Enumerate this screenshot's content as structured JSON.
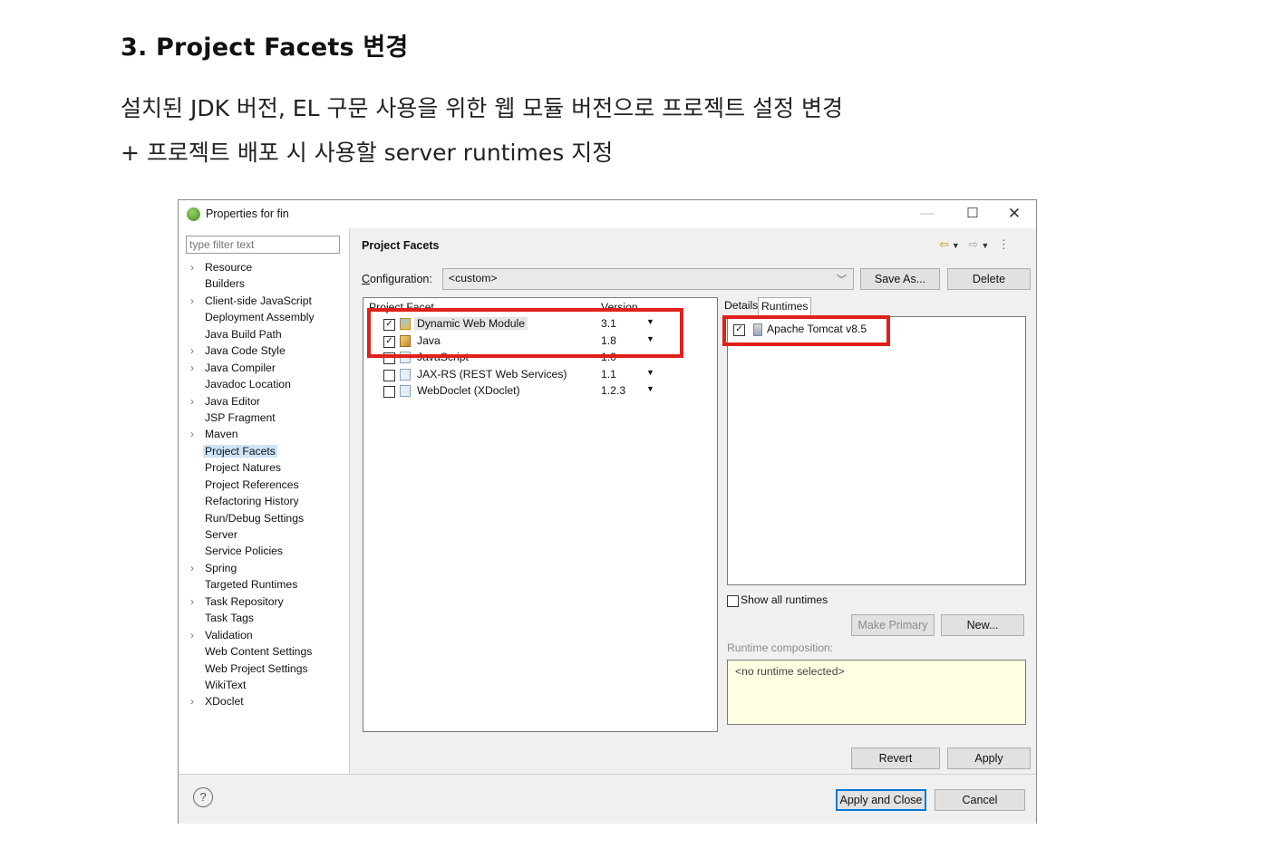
{
  "doc": {
    "heading": "3. Project Facets 변경",
    "line1": "설치된 JDK 버전, EL 구문 사용을 위한 웹 모듈 버전으로 프로젝트 설정 변경",
    "line2": "+ 프로젝트 배포 시 사용할 server runtimes 지정"
  },
  "dialog": {
    "title": "Properties for fin",
    "window_buttons": {
      "minimize": "—",
      "maximize": "☐",
      "close": "✕"
    },
    "filter_placeholder": "type filter text",
    "tree": [
      {
        "label": "Resource",
        "expandable": true,
        "selected": false
      },
      {
        "label": "Builders",
        "expandable": false,
        "selected": false
      },
      {
        "label": "Client-side JavaScript",
        "expandable": true,
        "selected": false
      },
      {
        "label": "Deployment Assembly",
        "expandable": false,
        "selected": false
      },
      {
        "label": "Java Build Path",
        "expandable": false,
        "selected": false
      },
      {
        "label": "Java Code Style",
        "expandable": true,
        "selected": false
      },
      {
        "label": "Java Compiler",
        "expandable": true,
        "selected": false
      },
      {
        "label": "Javadoc Location",
        "expandable": false,
        "selected": false
      },
      {
        "label": "Java Editor",
        "expandable": true,
        "selected": false
      },
      {
        "label": "JSP Fragment",
        "expandable": false,
        "selected": false
      },
      {
        "label": "Maven",
        "expandable": true,
        "selected": false
      },
      {
        "label": "Project Facets",
        "expandable": false,
        "selected": true
      },
      {
        "label": "Project Natures",
        "expandable": false,
        "selected": false
      },
      {
        "label": "Project References",
        "expandable": false,
        "selected": false
      },
      {
        "label": "Refactoring History",
        "expandable": false,
        "selected": false
      },
      {
        "label": "Run/Debug Settings",
        "expandable": false,
        "selected": false
      },
      {
        "label": "Server",
        "expandable": false,
        "selected": false
      },
      {
        "label": "Service Policies",
        "expandable": false,
        "selected": false
      },
      {
        "label": "Spring",
        "expandable": true,
        "selected": false
      },
      {
        "label": "Targeted Runtimes",
        "expandable": false,
        "selected": false
      },
      {
        "label": "Task Repository",
        "expandable": true,
        "selected": false
      },
      {
        "label": "Task Tags",
        "expandable": false,
        "selected": false
      },
      {
        "label": "Validation",
        "expandable": true,
        "selected": false
      },
      {
        "label": "Web Content Settings",
        "expandable": false,
        "selected": false
      },
      {
        "label": "Web Project Settings",
        "expandable": false,
        "selected": false
      },
      {
        "label": "WikiText",
        "expandable": false,
        "selected": false
      },
      {
        "label": "XDoclet",
        "expandable": true,
        "selected": false
      }
    ],
    "page_title": "Project Facets",
    "configuration_label": "Configuration:",
    "configuration_value": "<custom>",
    "save_as_label": "Save As...",
    "delete_label": "Delete",
    "facets_columns": {
      "facet": "Project Facet",
      "version": "Version"
    },
    "facets": [
      {
        "name": "Dynamic Web Module",
        "version": "3.1",
        "checked": true,
        "dropdown": true,
        "icon": "web-module-icon"
      },
      {
        "name": "Java",
        "version": "1.8",
        "checked": true,
        "dropdown": true,
        "icon": "java-icon"
      },
      {
        "name": "JavaScript",
        "version": "1.0",
        "checked": false,
        "dropdown": false,
        "icon": "file-icon"
      },
      {
        "name": "JAX-RS (REST Web Services)",
        "version": "1.1",
        "checked": false,
        "dropdown": true,
        "icon": "file-icon"
      },
      {
        "name": "WebDoclet (XDoclet)",
        "version": "1.2.3",
        "checked": false,
        "dropdown": true,
        "icon": "file-icon"
      }
    ],
    "tabs": {
      "details": "Details",
      "runtimes": "Runtimes"
    },
    "runtimes": [
      {
        "name": "Apache Tomcat v8.5",
        "checked": true
      }
    ],
    "show_all_runtimes": "Show all runtimes",
    "make_primary_label": "Make Primary",
    "new_label": "New...",
    "runtime_composition_label": "Runtime composition:",
    "runtime_composition_value": "<no runtime selected>",
    "revert_label": "Revert",
    "apply_label": "Apply",
    "apply_close_label": "Apply and Close",
    "cancel_label": "Cancel",
    "help_glyph": "?",
    "highlight_color": "#e0201b"
  }
}
